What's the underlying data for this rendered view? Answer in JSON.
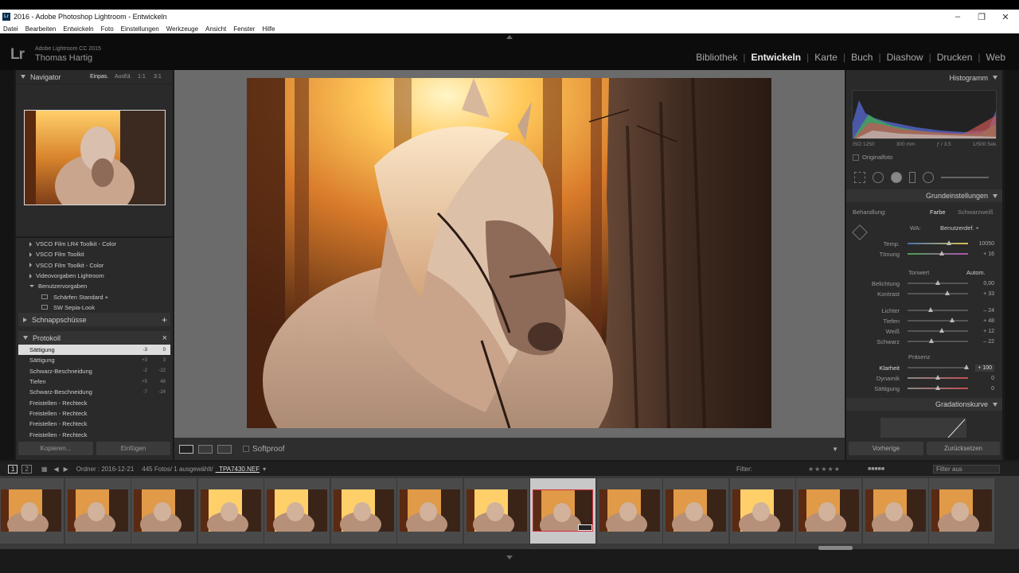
{
  "window": {
    "title": "2016 - Adobe Photoshop Lightroom - Entwickeln",
    "app_icon": "Lr"
  },
  "menu": [
    "Datei",
    "Bearbeiten",
    "Entwickeln",
    "Foto",
    "Einstellungen",
    "Werkzeuge",
    "Ansicht",
    "Fenster",
    "Hilfe"
  ],
  "identity": {
    "logo": "Lr",
    "product": "Adobe Lightroom CC 2015",
    "user": "Thomas Hartig"
  },
  "modules": [
    {
      "label": "Bibliothek",
      "active": false
    },
    {
      "label": "Entwickeln",
      "active": true
    },
    {
      "label": "Karte",
      "active": false
    },
    {
      "label": "Buch",
      "active": false
    },
    {
      "label": "Diashow",
      "active": false
    },
    {
      "label": "Drucken",
      "active": false
    },
    {
      "label": "Web",
      "active": false
    }
  ],
  "navigator": {
    "title": "Navigator",
    "zoom": [
      "Einpas.",
      "Ausfül.",
      "1:1",
      "3:1"
    ]
  },
  "presets": [
    {
      "label": "VSCO Film LR4 Toolkit - Color",
      "type": "folder"
    },
    {
      "label": "VSCO Film Toolkit",
      "type": "folder"
    },
    {
      "label": "VSCO Film Toolkit - Color",
      "type": "folder"
    },
    {
      "label": "Videovorgaben Lightroom",
      "type": "folder"
    },
    {
      "label": "Benutzervorgaben",
      "type": "open"
    },
    {
      "label": "Schärfen Standard +",
      "type": "item"
    },
    {
      "label": "SW Sepia-Look",
      "type": "item"
    }
  ],
  "snapshots": {
    "title": "Schnappschüsse",
    "add": "+"
  },
  "history": {
    "title": "Protokoll",
    "close": "×",
    "items": [
      {
        "label": "Sättigung",
        "v1": "-3",
        "v2": "0",
        "selected": true
      },
      {
        "label": "Sättigung",
        "v1": "+3",
        "v2": "3",
        "selected": false
      },
      {
        "label": "Schwarz-Beschneidung",
        "v1": "-2",
        "v2": "-22",
        "selected": false
      },
      {
        "label": "Tiefen",
        "v1": "+5",
        "v2": "48",
        "selected": false
      },
      {
        "label": "Schwarz-Beschneidung",
        "v1": "-7",
        "v2": "-24",
        "selected": false
      },
      {
        "label": "Freistellen - Rechteck",
        "v1": "",
        "v2": "",
        "selected": false
      },
      {
        "label": "Freistellen - Rechteck",
        "v1": "",
        "v2": "",
        "selected": false
      },
      {
        "label": "Freistellen - Rechteck",
        "v1": "",
        "v2": "",
        "selected": false
      },
      {
        "label": "Freistellen - Rechteck",
        "v1": "",
        "v2": "",
        "selected": false
      }
    ]
  },
  "left_buttons": {
    "copy": "Kopieren...",
    "paste": "Einfügen"
  },
  "toolbar": {
    "softproof": "Softproof"
  },
  "histogram": {
    "title": "Histogramm",
    "iso": "ISO 1250",
    "focal": "300 mm",
    "aperture": "ƒ / 3,5",
    "shutter": "1/500 Sek.",
    "original": "Originalfoto"
  },
  "basic": {
    "title": "Grundeinstellungen",
    "treatment_label": "Behandlung:",
    "treatment_color": "Farbe",
    "treatment_bw": "Schwarzweiß",
    "wb_label": "WA:",
    "wb_value": "Benutzerdef. ÷",
    "tone_group": "Tonwert",
    "auto": "Autom.",
    "presence_group": "Präsenz",
    "sliders": [
      {
        "label": "Temp.",
        "value": "10050",
        "pos": 0.68,
        "group": "wb"
      },
      {
        "label": "Tönung",
        "value": "+ 16",
        "pos": 0.56,
        "group": "wb"
      },
      {
        "label": "Belichtung",
        "value": "0,00",
        "pos": 0.5,
        "group": "tone"
      },
      {
        "label": "Kontrast",
        "value": "+ 33",
        "pos": 0.66,
        "group": "tone"
      },
      {
        "label": "Lichter",
        "value": "– 24",
        "pos": 0.38,
        "group": "tone"
      },
      {
        "label": "Tiefen",
        "value": "+ 48",
        "pos": 0.74,
        "group": "tone"
      },
      {
        "label": "Weiß",
        "value": "+ 12",
        "pos": 0.56,
        "group": "tone"
      },
      {
        "label": "Schwarz",
        "value": "– 22",
        "pos": 0.39,
        "group": "tone"
      },
      {
        "label": "Klarheit",
        "value": "+ 100",
        "pos": 0.97,
        "group": "presence"
      },
      {
        "label": "Dynamik",
        "value": "0",
        "pos": 0.5,
        "group": "presence"
      },
      {
        "label": "Sättigung",
        "value": "0",
        "pos": 0.5,
        "group": "presence"
      }
    ]
  },
  "tone_curve": {
    "title": "Gradationskurve"
  },
  "right_buttons": {
    "previous": "Vorherige",
    "reset": "Zurücksetzen"
  },
  "filmbar": {
    "page1": "1",
    "page2": "2",
    "source": "Ordner : 2016-12-21",
    "count": "445 Fotos/ 1 ausgewählt/",
    "filename": "_TPA7430.NEF",
    "filter_label": "Filter:",
    "filter_value": "Filter aus"
  },
  "filmstrip": {
    "count": 15,
    "selected_index": 8
  },
  "colors": {
    "accent_selection": "#d03040",
    "photo_warm": "#e8a34a"
  }
}
